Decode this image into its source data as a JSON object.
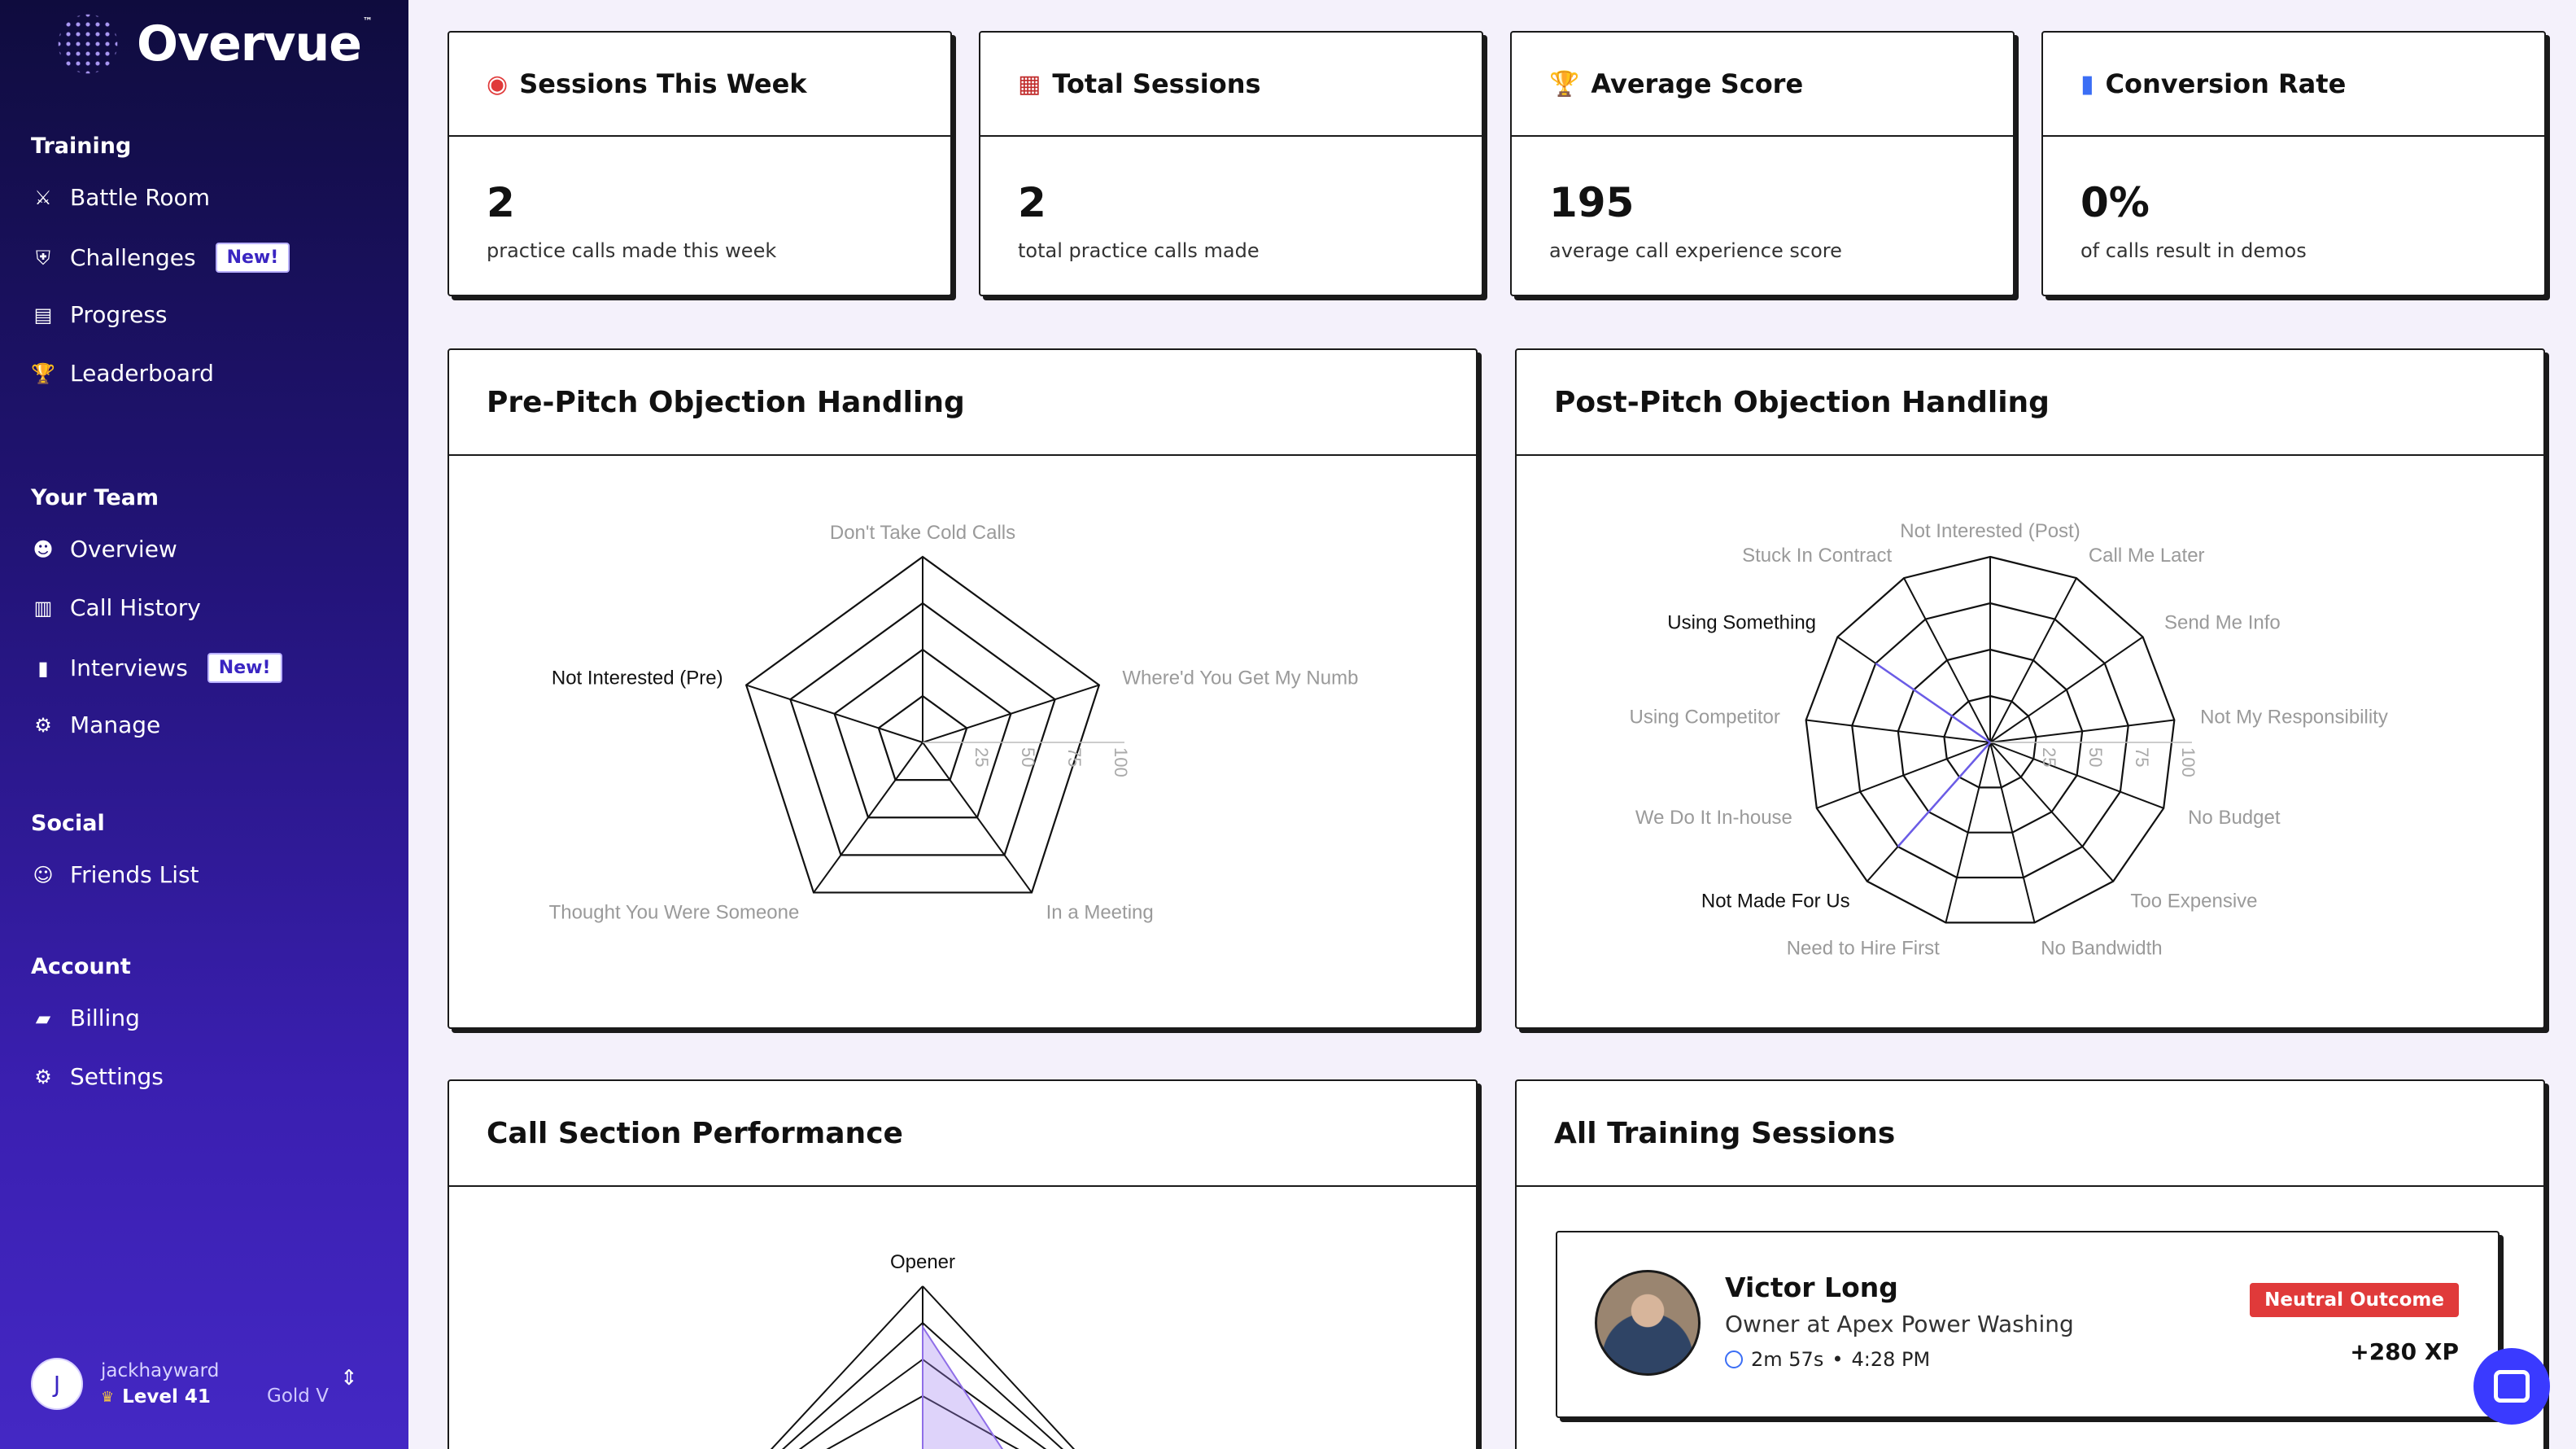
{
  "brand": {
    "name": "Overvue",
    "tm": "™"
  },
  "sidebar": {
    "sections": [
      {
        "title": "Training",
        "items": [
          {
            "label": "Battle Room",
            "icon": "swords-icon"
          },
          {
            "label": "Challenges",
            "icon": "shield-icon",
            "badge": "New!"
          },
          {
            "label": "Progress",
            "icon": "chart-icon"
          },
          {
            "label": "Leaderboard",
            "icon": "trophy-icon"
          }
        ]
      },
      {
        "title": "Your Team",
        "items": [
          {
            "label": "Overview",
            "icon": "team-icon"
          },
          {
            "label": "Call History",
            "icon": "clipboard-icon"
          },
          {
            "label": "Interviews",
            "icon": "notebook-icon",
            "badge": "New!"
          },
          {
            "label": "Manage",
            "icon": "gear-icon"
          }
        ]
      },
      {
        "title": "Social",
        "items": [
          {
            "label": "Friends List",
            "icon": "smile-icon"
          }
        ]
      },
      {
        "title": "Account",
        "items": [
          {
            "label": "Billing",
            "icon": "card-icon"
          },
          {
            "label": "Settings",
            "icon": "gear-icon"
          }
        ]
      }
    ],
    "user": {
      "initial": "J",
      "name": "jackhayward",
      "level": "Level 41",
      "rank": "Gold V"
    }
  },
  "stats": [
    {
      "title": "Sessions This Week",
      "icon": "target-icon",
      "value": "2",
      "sub": "practice calls made this week"
    },
    {
      "title": "Total Sessions",
      "icon": "calendar-icon",
      "value": "2",
      "sub": "total practice calls made"
    },
    {
      "title": "Average Score",
      "icon": "trophy-icon",
      "value": "195",
      "sub": "average call experience score"
    },
    {
      "title": "Conversion Rate",
      "icon": "bars-icon",
      "value": "0%",
      "sub": "of calls result in demos"
    }
  ],
  "pre_pitch": {
    "title": "Pre-Pitch Objection Handling"
  },
  "post_pitch": {
    "title": "Post-Pitch Objection Handling"
  },
  "call_section": {
    "title": "Call Section Performance",
    "top_label": "Opener"
  },
  "sessions": {
    "title": "All Training Sessions",
    "items": [
      {
        "name": "Victor Long",
        "role": "Owner at Apex Power Washing",
        "duration": "2m 57s",
        "time": "4:28 PM",
        "outcome": "Neutral Outcome",
        "xp": "+280 XP"
      }
    ]
  },
  "chart_data": [
    {
      "type": "radar",
      "title": "Pre-Pitch Objection Handling",
      "categories": [
        "Don't Take Cold Calls",
        "Where'd You Get My Numb",
        "In a Meeting",
        "Thought You Were Someone",
        "Not Interested (Pre)"
      ],
      "highlighted": [
        "Not Interested (Pre)"
      ],
      "values": [
        0,
        0,
        0,
        0,
        0
      ],
      "ticks": [
        "25",
        "50",
        "75",
        "100"
      ],
      "range": [
        0,
        100
      ]
    },
    {
      "type": "radar",
      "title": "Post-Pitch Objection Handling",
      "categories": [
        "Not Interested (Post)",
        "Call Me Later",
        "Send Me Info",
        "Not My Responsibility",
        "No Budget",
        "Too Expensive",
        "No Bandwidth",
        "Need to Hire First",
        "Not Made For Us",
        "We Do It In-house",
        "Using Competitor",
        "Using Something",
        "Stuck In Contract"
      ],
      "highlighted": [
        "Not Made For Us",
        "Using Something"
      ],
      "values": [
        0,
        0,
        0,
        0,
        0,
        0,
        0,
        0,
        75,
        0,
        0,
        75,
        0
      ],
      "ticks": [
        "25",
        "50",
        "75",
        "100"
      ],
      "range": [
        0,
        100
      ]
    },
    {
      "type": "radar",
      "title": "Call Section Performance",
      "categories": [
        "Opener"
      ],
      "range": [
        0,
        100
      ]
    }
  ]
}
